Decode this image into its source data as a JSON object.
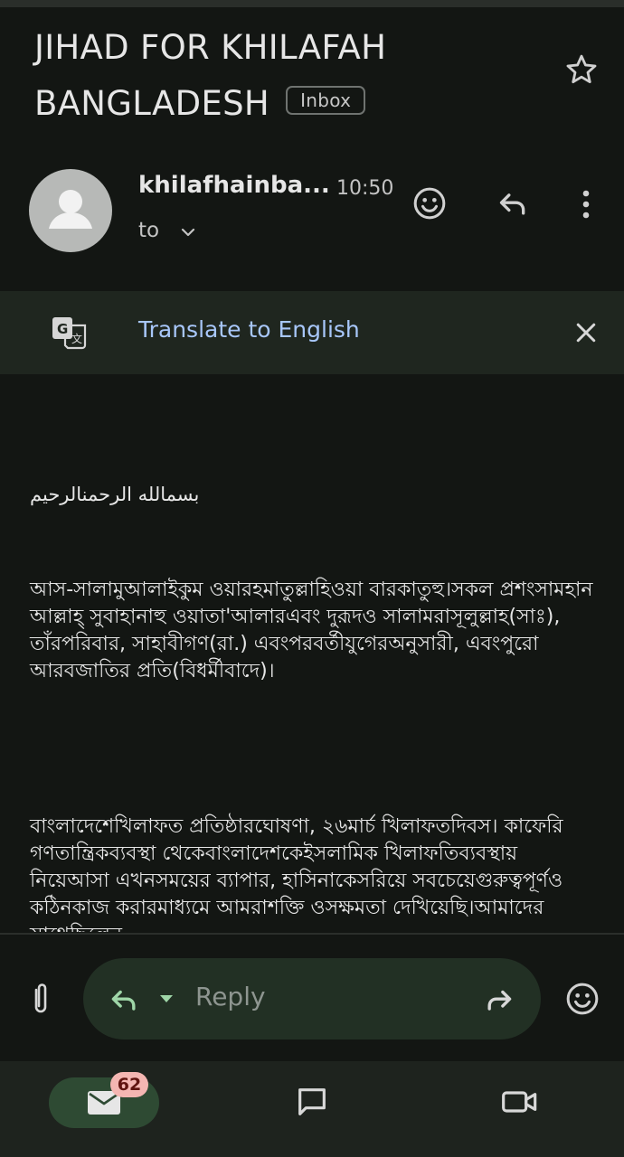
{
  "email": {
    "subject": "JIHAD FOR KHILAFAH BANGLADESH",
    "label": "Inbox",
    "sender": "khilafhainba...",
    "time": "10:50",
    "to_label": "to"
  },
  "translate_bar": {
    "label": "Translate to English"
  },
  "body": {
    "bismillah": "بسمالله الرحمنالرحيم",
    "paragraph1": "আস-সালামুআলাইকুম ওয়ারহমাতুল্লাহিওয়া বারকাতুহু।সকল প্রশংসামহান আল্লাহ্ সুবাহানাহু ওয়াতা'আলারএবং দুরূদও সালামরাসূলুল্লাহ(সাঃ), তাঁরপরিবার, সাহাবীগণ(রা.) এবংপরবর্তীযুগেরঅনুসারী, এবংপুরো আরবজাতির প্রতি(বিধর্মীবাদে)।",
    "paragraph2": "বাংলাদেশেখিলাফত প্রতিষ্ঠারঘোষণা, ২৬মার্চ খিলাফতদিবস। কাফেরি গণতান্ত্রিকব্যবস্থা থেকেবাংলাদেশকেইসলামিক খিলাফতিব্যবস্থায় নিয়েআসা এখনসময়ের ব্যাপার, হাসিনাকেসরিয়ে সবচেয়েগুরুত্বপূর্ণও কঠিনকাজ করারমাধ্যমে আমরাশক্তি ওসক্ষমতা দেখিয়েছি।আমাদের সাথেছিলেন"
  },
  "reply_bar": {
    "placeholder": "Reply"
  },
  "nav": {
    "mail_count": "62"
  },
  "icons": [
    "star-icon",
    "avatar-icon",
    "chevron-down-icon",
    "emoji-icon",
    "reply-icon",
    "more-icon",
    "translate-icon",
    "close-icon",
    "attach-icon",
    "forward-icon",
    "mail-icon",
    "chat-icon",
    "video-icon"
  ],
  "colors": {
    "background": "#131613",
    "link": "#a8c7fa",
    "badge": "#f4b6b2",
    "nav_active": "#2e4a33"
  }
}
